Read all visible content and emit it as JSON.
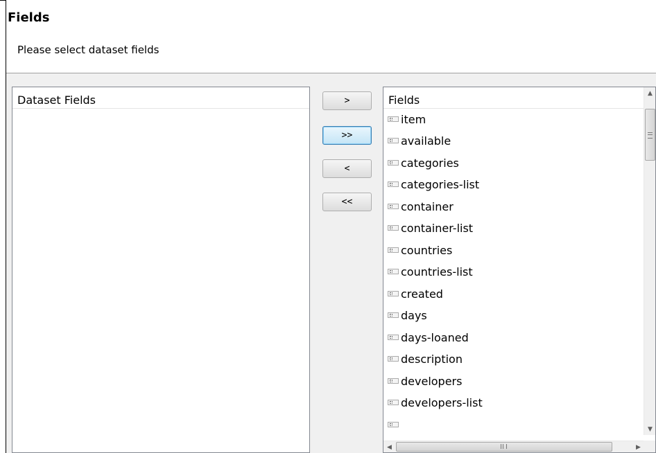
{
  "header": {
    "title": "Fields",
    "description": "Please select dataset fields"
  },
  "left_panel": {
    "header": "Dataset Fields",
    "items": []
  },
  "buttons": {
    "add": ">",
    "add_all": ">>",
    "remove": "<",
    "remove_all": "<<"
  },
  "right_panel": {
    "header": "Fields",
    "items": [
      {
        "label": "item"
      },
      {
        "label": "available"
      },
      {
        "label": "categories"
      },
      {
        "label": "categories-list"
      },
      {
        "label": "container"
      },
      {
        "label": "container-list"
      },
      {
        "label": "countries"
      },
      {
        "label": "countries-list"
      },
      {
        "label": "created"
      },
      {
        "label": "days"
      },
      {
        "label": "days-loaned"
      },
      {
        "label": "description"
      },
      {
        "label": "developers"
      },
      {
        "label": "developers-list"
      }
    ],
    "item_icon": "field-icon"
  },
  "colors": {
    "panel_border": "#828790",
    "body_background": "#f0f0f0",
    "focus_border": "#3c7fb1"
  }
}
